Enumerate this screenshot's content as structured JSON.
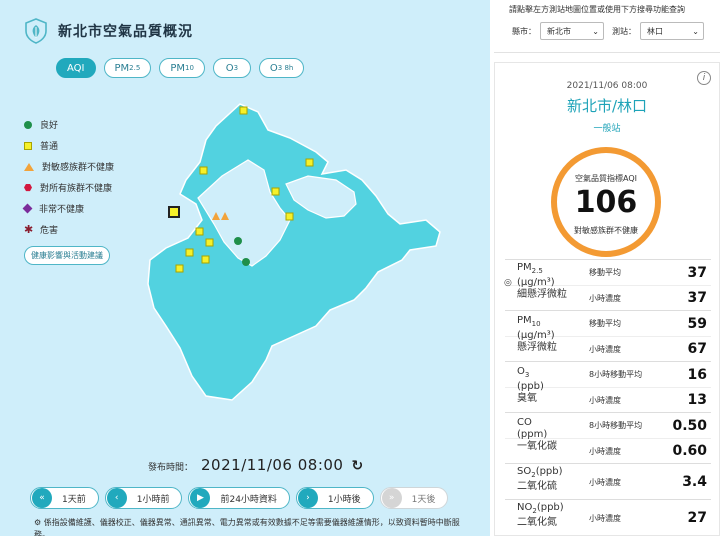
{
  "header": {
    "title": "新北市空氣品質概況"
  },
  "tabs": [
    {
      "label": "AQI",
      "sub": "",
      "active": true
    },
    {
      "label": "PM",
      "sub": "2.5",
      "active": false
    },
    {
      "label": "PM",
      "sub": "10",
      "active": false
    },
    {
      "label": "O",
      "sub": "3",
      "active": false
    },
    {
      "label": "O",
      "sub": "3 8h",
      "active": false
    }
  ],
  "legend": {
    "items": [
      {
        "label": "良好",
        "marker": "circle"
      },
      {
        "label": "普通",
        "marker": "square"
      },
      {
        "label": "對敏感族群不健康",
        "marker": "triangle"
      },
      {
        "label": "對所有族群不健康",
        "marker": "hexagon"
      },
      {
        "label": "非常不健康",
        "marker": "diamond"
      },
      {
        "label": "危害",
        "marker": "star"
      }
    ],
    "health_button": "健康影響與活動建議"
  },
  "colors": {
    "accent": "#21a9bd",
    "map_fill": "#52d2e0",
    "aqi_ring": "#f39a33",
    "good": "#1f8f4a",
    "moderate": "#f6f12a",
    "sensitive": "#f2a33a"
  },
  "publish": {
    "label": "發布時間：",
    "time": "2021/11/06 08:00",
    "refresh_icon": "refresh-icon"
  },
  "timeline": {
    "day_before": "1天前",
    "hour_before": "1小時前",
    "play_24h": "前24小時資料",
    "hour_after": "1小時後",
    "day_after": "1天後"
  },
  "note": "係指設備維護、儀器校正、儀器異常、通訊異常、電力異常或有效數據不足等需要儀器維護情形，以致資料暫時中斷服務。",
  "search": {
    "hint": "請點擊左方測站地圖位置或使用下方搜尋功能查詢",
    "county_label": "縣市：",
    "county_value": "新北市",
    "station_label": "測站：",
    "station_value": "林口"
  },
  "station": {
    "time": "2021/11/06 08:00",
    "name": "新北市/林口",
    "type": "一般站",
    "aqi_label": "空氣品質指標AQI",
    "aqi_value": "106",
    "aqi_status": "對敏感族群不健康"
  },
  "pollutants": [
    {
      "name": "PM",
      "sub": "2.5",
      "unit": "(μg/m³)",
      "cname": "細懸浮微粒",
      "rows": [
        {
          "label": "移動平均",
          "value": "37"
        },
        {
          "label": "小時濃度",
          "value": "37"
        }
      ]
    },
    {
      "name": "PM",
      "sub": "10",
      "unit": "(μg/m³)",
      "cname": "懸浮微粒",
      "rows": [
        {
          "label": "移動平均",
          "value": "59"
        },
        {
          "label": "小時濃度",
          "value": "67"
        }
      ]
    },
    {
      "name": "O",
      "sub": "3",
      "unit": "(ppb)",
      "cname": "臭氧",
      "rows": [
        {
          "label": "8小時移動平均",
          "value": "16"
        },
        {
          "label": "小時濃度",
          "value": "13"
        }
      ]
    },
    {
      "name": "CO",
      "sub": "",
      "unit": "(ppm)",
      "cname": "一氧化碳",
      "rows": [
        {
          "label": "8小時移動平均",
          "value": "0.50"
        },
        {
          "label": "小時濃度",
          "value": "0.60"
        }
      ]
    },
    {
      "name": "SO",
      "sub": "2",
      "unit": "(ppb)",
      "cname": "二氧化硫",
      "rows": [
        {
          "label": "小時濃度",
          "value": "3.4"
        }
      ]
    },
    {
      "name": "NO",
      "sub": "2",
      "unit": "(ppb)",
      "cname": "二氧化氮",
      "rows": [
        {
          "label": "小時濃度",
          "value": "27"
        }
      ]
    }
  ]
}
